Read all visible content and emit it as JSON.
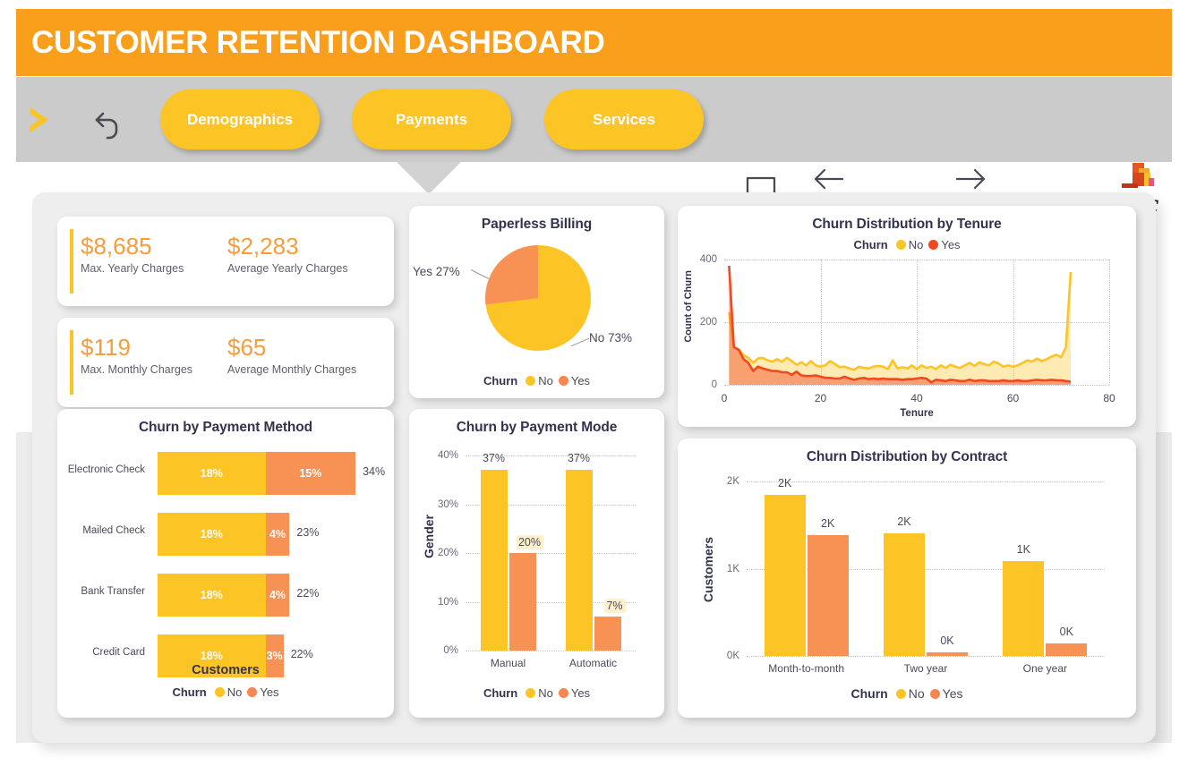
{
  "header": {
    "title": "CUSTOMER RETENTION DASHBOARD",
    "banner_color": "#F99F1C"
  },
  "nav": {
    "chevron_icon": "chevron-right-icon",
    "back_icon": "undo-arrow-icon",
    "buttons": [
      {
        "label": "Demographics"
      },
      {
        "label": "Payments",
        "active": true
      },
      {
        "label": "Services"
      }
    ],
    "comment_icon": "comment-bubble-icon",
    "logo": "pwc-logo",
    "prev_icon": "arrow-left-icon",
    "next_icon": "arrow-right-icon",
    "button_color": "#FDC425"
  },
  "kpis": [
    {
      "value": "$8,685",
      "label": "Max. Yearly Charges"
    },
    {
      "value": "$2,283",
      "label": "Average Yearly Charges"
    },
    {
      "value": "$119",
      "label": "Max. Monthly Charges"
    },
    {
      "value": "$65",
      "label": "Average Monthly Charges"
    }
  ],
  "legend": {
    "title": "Churn",
    "no": "No",
    "yes": "Yes"
  },
  "chart_data": [
    {
      "id": "paperless_billing",
      "type": "pie",
      "title": "Paperless Billing",
      "categories": [
        "No",
        "Yes"
      ],
      "values": [
        73,
        27
      ],
      "labels": [
        "No 73%",
        "Yes 27%"
      ],
      "colors": [
        "#FDC425",
        "#F89154"
      ],
      "legend_title": "Churn",
      "legend_position": "bottom"
    },
    {
      "id": "churn_by_tenure",
      "type": "area",
      "title": "Churn Distribution by Tenure",
      "xlabel": "Tenure",
      "ylabel": "Count of Churn",
      "xlim": [
        0,
        80
      ],
      "ylim": [
        0,
        400
      ],
      "xticks": [
        "0",
        "20",
        "40",
        "60",
        "80"
      ],
      "yticks": [
        "0",
        "200",
        "400"
      ],
      "grid": true,
      "legend_title": "Churn",
      "legend_position": "top",
      "series": [
        {
          "name": "No",
          "color": "#FDC425",
          "x": [
            1,
            2,
            3,
            4,
            5,
            6,
            7,
            8,
            9,
            10,
            11,
            12,
            13,
            14,
            15,
            16,
            17,
            18,
            19,
            20,
            21,
            22,
            23,
            24,
            25,
            26,
            27,
            28,
            29,
            30,
            31,
            32,
            33,
            34,
            35,
            36,
            37,
            38,
            39,
            40,
            41,
            42,
            43,
            44,
            45,
            46,
            47,
            48,
            49,
            50,
            51,
            52,
            53,
            54,
            55,
            56,
            57,
            58,
            59,
            60,
            61,
            62,
            63,
            64,
            65,
            66,
            67,
            68,
            69,
            70,
            71,
            72
          ],
          "values": [
            232,
            120,
            112,
            95,
            86,
            70,
            84,
            86,
            78,
            74,
            82,
            74,
            86,
            76,
            64,
            72,
            62,
            76,
            62,
            58,
            62,
            76,
            66,
            56,
            58,
            52,
            48,
            58,
            54,
            52,
            58,
            60,
            58,
            50,
            78,
            52,
            56,
            52,
            62,
            50,
            62,
            54,
            58,
            50,
            62,
            54,
            64,
            58,
            54,
            62,
            70,
            60,
            72,
            66,
            62,
            74,
            68,
            58,
            62,
            58,
            62,
            70,
            78,
            74,
            84,
            76,
            82,
            90,
            96,
            88,
            120,
            360
          ]
        },
        {
          "name": "Yes",
          "color": "#F5471E",
          "x": [
            1,
            2,
            3,
            4,
            5,
            6,
            7,
            8,
            9,
            10,
            11,
            12,
            13,
            14,
            15,
            16,
            17,
            18,
            19,
            20,
            21,
            22,
            23,
            24,
            25,
            26,
            27,
            28,
            29,
            30,
            31,
            32,
            33,
            34,
            35,
            36,
            37,
            38,
            39,
            40,
            41,
            42,
            43,
            44,
            45,
            46,
            47,
            48,
            49,
            50,
            51,
            52,
            53,
            54,
            55,
            56,
            57,
            58,
            59,
            60,
            61,
            62,
            63,
            64,
            65,
            66,
            67,
            68,
            69,
            70,
            71,
            72
          ],
          "values": [
            380,
            120,
            112,
            82,
            70,
            44,
            58,
            52,
            48,
            44,
            44,
            40,
            40,
            32,
            42,
            30,
            28,
            28,
            30,
            26,
            22,
            22,
            20,
            20,
            26,
            20,
            16,
            20,
            22,
            18,
            20,
            18,
            20,
            18,
            18,
            18,
            16,
            18,
            18,
            20,
            22,
            20,
            8,
            16,
            14,
            12,
            16,
            14,
            12,
            12,
            16,
            12,
            14,
            14,
            12,
            12,
            12,
            14,
            12,
            12,
            14,
            12,
            12,
            14,
            16,
            14,
            14,
            16,
            14,
            14,
            12,
            10
          ]
        }
      ]
    },
    {
      "id": "churn_by_payment_method",
      "type": "bar",
      "orientation": "horizontal",
      "title": "Churn by Payment Method",
      "xlabel": "Customers",
      "legend_title": "Churn",
      "legend_position": "bottom",
      "categories": [
        "Electronic Check",
        "Mailed Check",
        "Bank Transfer",
        "Credit Card"
      ],
      "series": [
        {
          "name": "No",
          "color": "#FDC425",
          "values": [
            18,
            18,
            18,
            18
          ],
          "labels": [
            "18%",
            "18%",
            "18%",
            "18%"
          ]
        },
        {
          "name": "Yes",
          "color": "#F89154",
          "values": [
            15,
            4,
            4,
            3
          ],
          "labels": [
            "15%",
            "4%",
            "4%",
            "3%"
          ]
        }
      ],
      "totals": [
        "34%",
        "23%",
        "22%",
        "22%"
      ]
    },
    {
      "id": "churn_by_payment_mode",
      "type": "bar",
      "orientation": "vertical",
      "title": "Churn by Payment Mode",
      "ylabel": "Gender",
      "ylim": [
        0,
        40
      ],
      "yticks": [
        "0%",
        "10%",
        "20%",
        "30%",
        "40%"
      ],
      "grid": true,
      "legend_title": "Churn",
      "legend_position": "bottom",
      "categories": [
        "Manual",
        "Automatic"
      ],
      "series": [
        {
          "name": "No",
          "color": "#FDC425",
          "values": [
            37,
            37
          ],
          "labels": [
            "37%",
            "37%"
          ]
        },
        {
          "name": "Yes",
          "color": "#F89154",
          "values": [
            20,
            7
          ],
          "labels": [
            "20%",
            "7%"
          ]
        }
      ]
    },
    {
      "id": "churn_by_contract",
      "type": "bar",
      "orientation": "vertical",
      "title": "Churn Distribution by Contract",
      "ylabel": "Customers",
      "ylim": [
        0,
        2400
      ],
      "yticks": [
        "0K",
        "1K",
        "2K"
      ],
      "grid": true,
      "legend_title": "Churn",
      "legend_position": "bottom",
      "categories": [
        "Month-to-month",
        "Two year",
        "One year"
      ],
      "series": [
        {
          "name": "No",
          "color": "#FDC425",
          "values": [
            2220,
            1690,
            1310
          ],
          "labels": [
            "2K",
            "2K",
            "1K"
          ]
        },
        {
          "name": "Yes",
          "color": "#F89154",
          "values": [
            1660,
            50,
            170
          ],
          "labels": [
            "2K",
            "0K",
            "0K"
          ]
        }
      ]
    }
  ]
}
